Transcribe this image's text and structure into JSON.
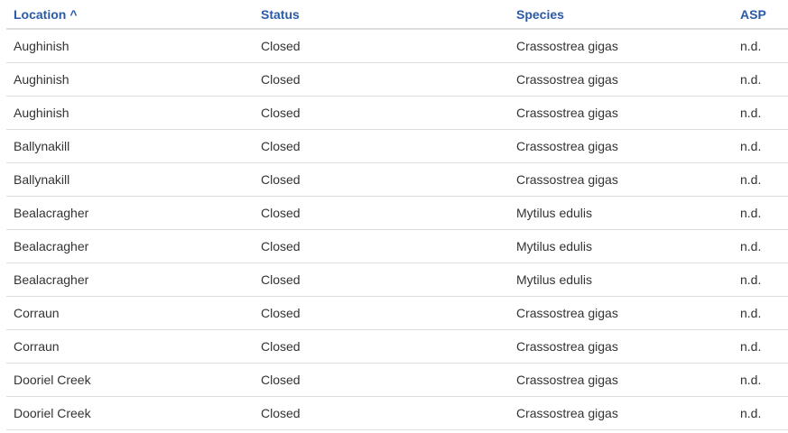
{
  "table": {
    "columns": [
      {
        "label": "Location",
        "sort_indicator": "^"
      },
      {
        "label": "Status"
      },
      {
        "label": "Species"
      },
      {
        "label": "ASP"
      }
    ],
    "rows": [
      [
        "Aughinish",
        "Closed",
        "Crassostrea gigas",
        "n.d."
      ],
      [
        "Aughinish",
        "Closed",
        "Crassostrea gigas",
        "n.d."
      ],
      [
        "Aughinish",
        "Closed",
        "Crassostrea gigas",
        "n.d."
      ],
      [
        "Ballynakill",
        "Closed",
        "Crassostrea gigas",
        "n.d."
      ],
      [
        "Ballynakill",
        "Closed",
        "Crassostrea gigas",
        "n.d."
      ],
      [
        "Bealacragher",
        "Closed",
        "Mytilus edulis",
        "n.d."
      ],
      [
        "Bealacragher",
        "Closed",
        "Mytilus edulis",
        "n.d."
      ],
      [
        "Bealacragher",
        "Closed",
        "Mytilus edulis",
        "n.d."
      ],
      [
        "Corraun",
        "Closed",
        "Crassostrea gigas",
        "n.d."
      ],
      [
        "Corraun",
        "Closed",
        "Crassostrea gigas",
        "n.d."
      ],
      [
        "Dooriel Creek",
        "Closed",
        "Crassostrea gigas",
        "n.d."
      ],
      [
        "Dooriel Creek",
        "Closed",
        "Crassostrea gigas",
        "n.d."
      ]
    ]
  },
  "colors": {
    "header_text": "#2a5aa8",
    "cell_text": "#333333",
    "row_border": "#dddddd"
  }
}
